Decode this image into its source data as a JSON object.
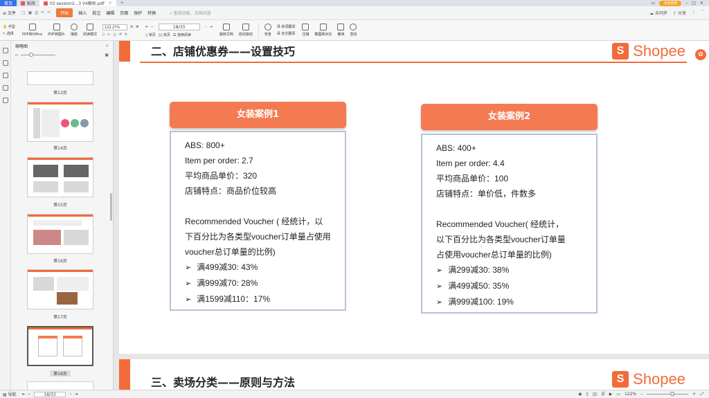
{
  "titlebar": {
    "home_tab": "首页",
    "tab1": "稻壳",
    "tab2": "02 session2...3 V4解析.pdf",
    "login": "点此登录"
  },
  "menubar": {
    "file": "文件",
    "items": [
      "开始",
      "插入",
      "批注",
      "编辑",
      "页面",
      "保护",
      "转换"
    ],
    "search": "查找功能、文档内容",
    "unsync": "未同步",
    "share": "分享"
  },
  "toolbar": {
    "hand": "手型",
    "select": "选择",
    "pdf_office": "PDF转Office",
    "pdf_image": "PDF转图片",
    "play": "播放",
    "read_mode": "阅读模式",
    "zoom_value": "122.27%",
    "page_value": "18/33",
    "rotate": "旋转文档",
    "single": "单页",
    "double": "双页",
    "continuous": "连续阅读",
    "auto_scroll": "自动滚动",
    "background": "背景",
    "translate": "划词翻译",
    "full_translate": "全文翻译",
    "compress": "压缩",
    "screenshot": "截图和对比",
    "read_aloud": "朗读",
    "find": "查找"
  },
  "thumbs": {
    "title": "缩略图",
    "labels": [
      "第13页",
      "第14页",
      "第15页",
      "第16页",
      "第17页",
      "第18页"
    ]
  },
  "page1": {
    "heading": "二、店铺优惠券——设置技巧",
    "brand": "Shopee",
    "case1": {
      "title": "女装案例1",
      "abs": "ABS: 800+",
      "ipo": "Item per order: 2.7",
      "avg": "平均商品单价：320",
      "feature": "店铺特点：商品价位较高",
      "rec1": "Recommended Voucher ( 经统计，以",
      "rec2": "下百分比为各类型voucher订单量占使用",
      "rec3": "voucher总订单量的比例)",
      "v1": "满499减30: 43%",
      "v2": "满999减70: 28%",
      "v3": "满1599减110：17%"
    },
    "case2": {
      "title": "女装案例2",
      "abs": "ABS: 400+",
      "ipo": "Item per order: 4.4",
      "avg": "平均商品单价：100",
      "feature": "店铺特点：单价低，件数多",
      "rec1": "Recommended Voucher( 经统计，",
      "rec2": "以下百分比为各类型voucher订单量",
      "rec3": "占使用voucher总订单量的比例)",
      "v1": "满299减30: 38%",
      "v2": "满499减50: 35%",
      "v3": "满999减100: 19%"
    }
  },
  "page2": {
    "heading": "三、卖场分类——原则与方法",
    "brand": "Shopee"
  },
  "status": {
    "nav": "导航",
    "page": "18/33",
    "zoom": "122%"
  },
  "colors": {
    "accent": "#f26b3a",
    "card_header": "#f47a52",
    "card_border": "#b8c2d6"
  }
}
